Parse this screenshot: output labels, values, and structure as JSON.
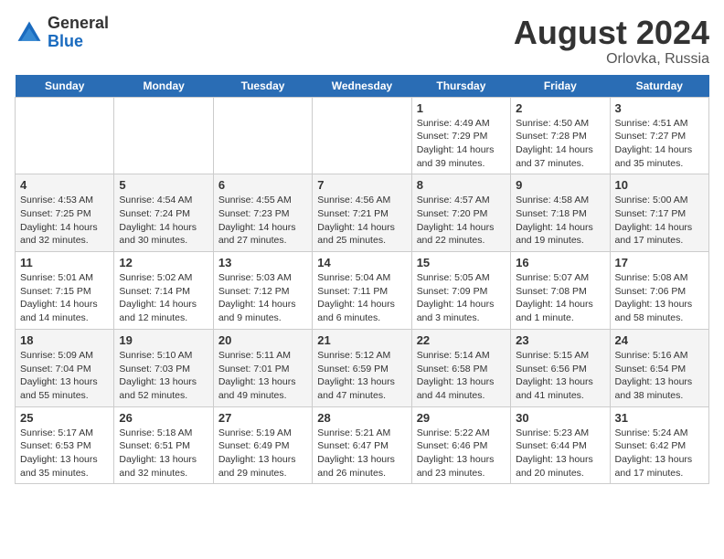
{
  "header": {
    "logo_general": "General",
    "logo_blue": "Blue",
    "month_title": "August 2024",
    "location": "Orlovka, Russia"
  },
  "calendar": {
    "days_of_week": [
      "Sunday",
      "Monday",
      "Tuesday",
      "Wednesday",
      "Thursday",
      "Friday",
      "Saturday"
    ],
    "weeks": [
      [
        {
          "day": "",
          "info": ""
        },
        {
          "day": "",
          "info": ""
        },
        {
          "day": "",
          "info": ""
        },
        {
          "day": "",
          "info": ""
        },
        {
          "day": "1",
          "info": "Sunrise: 4:49 AM\nSunset: 7:29 PM\nDaylight: 14 hours\nand 39 minutes."
        },
        {
          "day": "2",
          "info": "Sunrise: 4:50 AM\nSunset: 7:28 PM\nDaylight: 14 hours\nand 37 minutes."
        },
        {
          "day": "3",
          "info": "Sunrise: 4:51 AM\nSunset: 7:27 PM\nDaylight: 14 hours\nand 35 minutes."
        }
      ],
      [
        {
          "day": "4",
          "info": "Sunrise: 4:53 AM\nSunset: 7:25 PM\nDaylight: 14 hours\nand 32 minutes."
        },
        {
          "day": "5",
          "info": "Sunrise: 4:54 AM\nSunset: 7:24 PM\nDaylight: 14 hours\nand 30 minutes."
        },
        {
          "day": "6",
          "info": "Sunrise: 4:55 AM\nSunset: 7:23 PM\nDaylight: 14 hours\nand 27 minutes."
        },
        {
          "day": "7",
          "info": "Sunrise: 4:56 AM\nSunset: 7:21 PM\nDaylight: 14 hours\nand 25 minutes."
        },
        {
          "day": "8",
          "info": "Sunrise: 4:57 AM\nSunset: 7:20 PM\nDaylight: 14 hours\nand 22 minutes."
        },
        {
          "day": "9",
          "info": "Sunrise: 4:58 AM\nSunset: 7:18 PM\nDaylight: 14 hours\nand 19 minutes."
        },
        {
          "day": "10",
          "info": "Sunrise: 5:00 AM\nSunset: 7:17 PM\nDaylight: 14 hours\nand 17 minutes."
        }
      ],
      [
        {
          "day": "11",
          "info": "Sunrise: 5:01 AM\nSunset: 7:15 PM\nDaylight: 14 hours\nand 14 minutes."
        },
        {
          "day": "12",
          "info": "Sunrise: 5:02 AM\nSunset: 7:14 PM\nDaylight: 14 hours\nand 12 minutes."
        },
        {
          "day": "13",
          "info": "Sunrise: 5:03 AM\nSunset: 7:12 PM\nDaylight: 14 hours\nand 9 minutes."
        },
        {
          "day": "14",
          "info": "Sunrise: 5:04 AM\nSunset: 7:11 PM\nDaylight: 14 hours\nand 6 minutes."
        },
        {
          "day": "15",
          "info": "Sunrise: 5:05 AM\nSunset: 7:09 PM\nDaylight: 14 hours\nand 3 minutes."
        },
        {
          "day": "16",
          "info": "Sunrise: 5:07 AM\nSunset: 7:08 PM\nDaylight: 14 hours\nand 1 minute."
        },
        {
          "day": "17",
          "info": "Sunrise: 5:08 AM\nSunset: 7:06 PM\nDaylight: 13 hours\nand 58 minutes."
        }
      ],
      [
        {
          "day": "18",
          "info": "Sunrise: 5:09 AM\nSunset: 7:04 PM\nDaylight: 13 hours\nand 55 minutes."
        },
        {
          "day": "19",
          "info": "Sunrise: 5:10 AM\nSunset: 7:03 PM\nDaylight: 13 hours\nand 52 minutes."
        },
        {
          "day": "20",
          "info": "Sunrise: 5:11 AM\nSunset: 7:01 PM\nDaylight: 13 hours\nand 49 minutes."
        },
        {
          "day": "21",
          "info": "Sunrise: 5:12 AM\nSunset: 6:59 PM\nDaylight: 13 hours\nand 47 minutes."
        },
        {
          "day": "22",
          "info": "Sunrise: 5:14 AM\nSunset: 6:58 PM\nDaylight: 13 hours\nand 44 minutes."
        },
        {
          "day": "23",
          "info": "Sunrise: 5:15 AM\nSunset: 6:56 PM\nDaylight: 13 hours\nand 41 minutes."
        },
        {
          "day": "24",
          "info": "Sunrise: 5:16 AM\nSunset: 6:54 PM\nDaylight: 13 hours\nand 38 minutes."
        }
      ],
      [
        {
          "day": "25",
          "info": "Sunrise: 5:17 AM\nSunset: 6:53 PM\nDaylight: 13 hours\nand 35 minutes."
        },
        {
          "day": "26",
          "info": "Sunrise: 5:18 AM\nSunset: 6:51 PM\nDaylight: 13 hours\nand 32 minutes."
        },
        {
          "day": "27",
          "info": "Sunrise: 5:19 AM\nSunset: 6:49 PM\nDaylight: 13 hours\nand 29 minutes."
        },
        {
          "day": "28",
          "info": "Sunrise: 5:21 AM\nSunset: 6:47 PM\nDaylight: 13 hours\nand 26 minutes."
        },
        {
          "day": "29",
          "info": "Sunrise: 5:22 AM\nSunset: 6:46 PM\nDaylight: 13 hours\nand 23 minutes."
        },
        {
          "day": "30",
          "info": "Sunrise: 5:23 AM\nSunset: 6:44 PM\nDaylight: 13 hours\nand 20 minutes."
        },
        {
          "day": "31",
          "info": "Sunrise: 5:24 AM\nSunset: 6:42 PM\nDaylight: 13 hours\nand 17 minutes."
        }
      ]
    ]
  }
}
